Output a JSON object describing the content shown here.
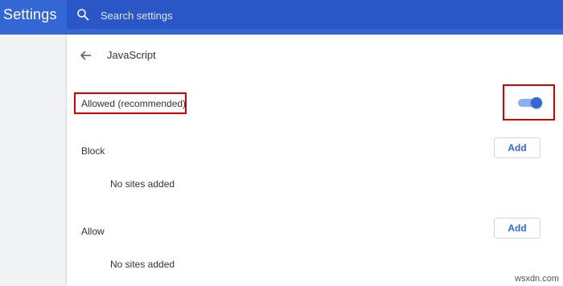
{
  "app": {
    "title": "Settings"
  },
  "search": {
    "placeholder": "Search settings",
    "value": ""
  },
  "page": {
    "title": "JavaScript"
  },
  "main_setting": {
    "label": "Allowed (recommended)",
    "enabled": true
  },
  "block": {
    "label": "Block",
    "add_label": "Add",
    "empty_text": "No sites added"
  },
  "allow": {
    "label": "Allow",
    "add_label": "Add",
    "empty_text": "No sites added"
  },
  "watermark": "wsxdn.com",
  "colors": {
    "header": "#3367d6",
    "search_bar": "#2a56c6",
    "accent": "#3367d6",
    "highlight_box": "#d20000",
    "background": "#f1f3f4"
  },
  "icons": {
    "search": "search-icon",
    "back": "arrow-back-icon"
  }
}
